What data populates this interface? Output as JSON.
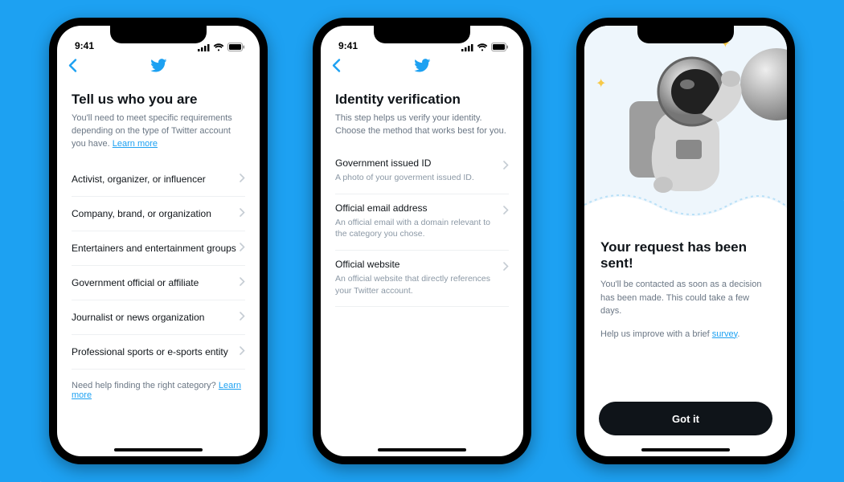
{
  "statusbar": {
    "time": "9:41"
  },
  "screen1": {
    "title": "Tell us who you are",
    "subtitle_pre": "You'll need to meet specific requirements depending on the type of Twitter account you have. ",
    "subtitle_link": "Learn more",
    "categories": [
      "Activist, organizer, or influencer",
      "Company, brand, or organization",
      "Entertainers and entertainment groups",
      "Government official or affiliate",
      "Journalist or news organization",
      "Professional sports or e-sports entity"
    ],
    "help_pre": "Need help finding the right category? ",
    "help_link": "Learn more"
  },
  "screen2": {
    "title": "Identity verification",
    "subtitle": "This step helps us verify your identity. Choose the method that works best for you.",
    "methods": [
      {
        "title": "Government issued ID",
        "desc": "A photo of your goverment issued ID."
      },
      {
        "title": "Official email address",
        "desc": "An official email with a domain relevant to the category you chose."
      },
      {
        "title": "Official website",
        "desc": "An official website that directly references your Twitter account."
      }
    ]
  },
  "screen3": {
    "title": "Your request has been sent!",
    "subtitle": "You'll be contacted as soon as a decision has been made. This could take a few days.",
    "survey_pre": "Help us improve with a brief ",
    "survey_link": "survey",
    "survey_post": ".",
    "cta": "Got it"
  }
}
